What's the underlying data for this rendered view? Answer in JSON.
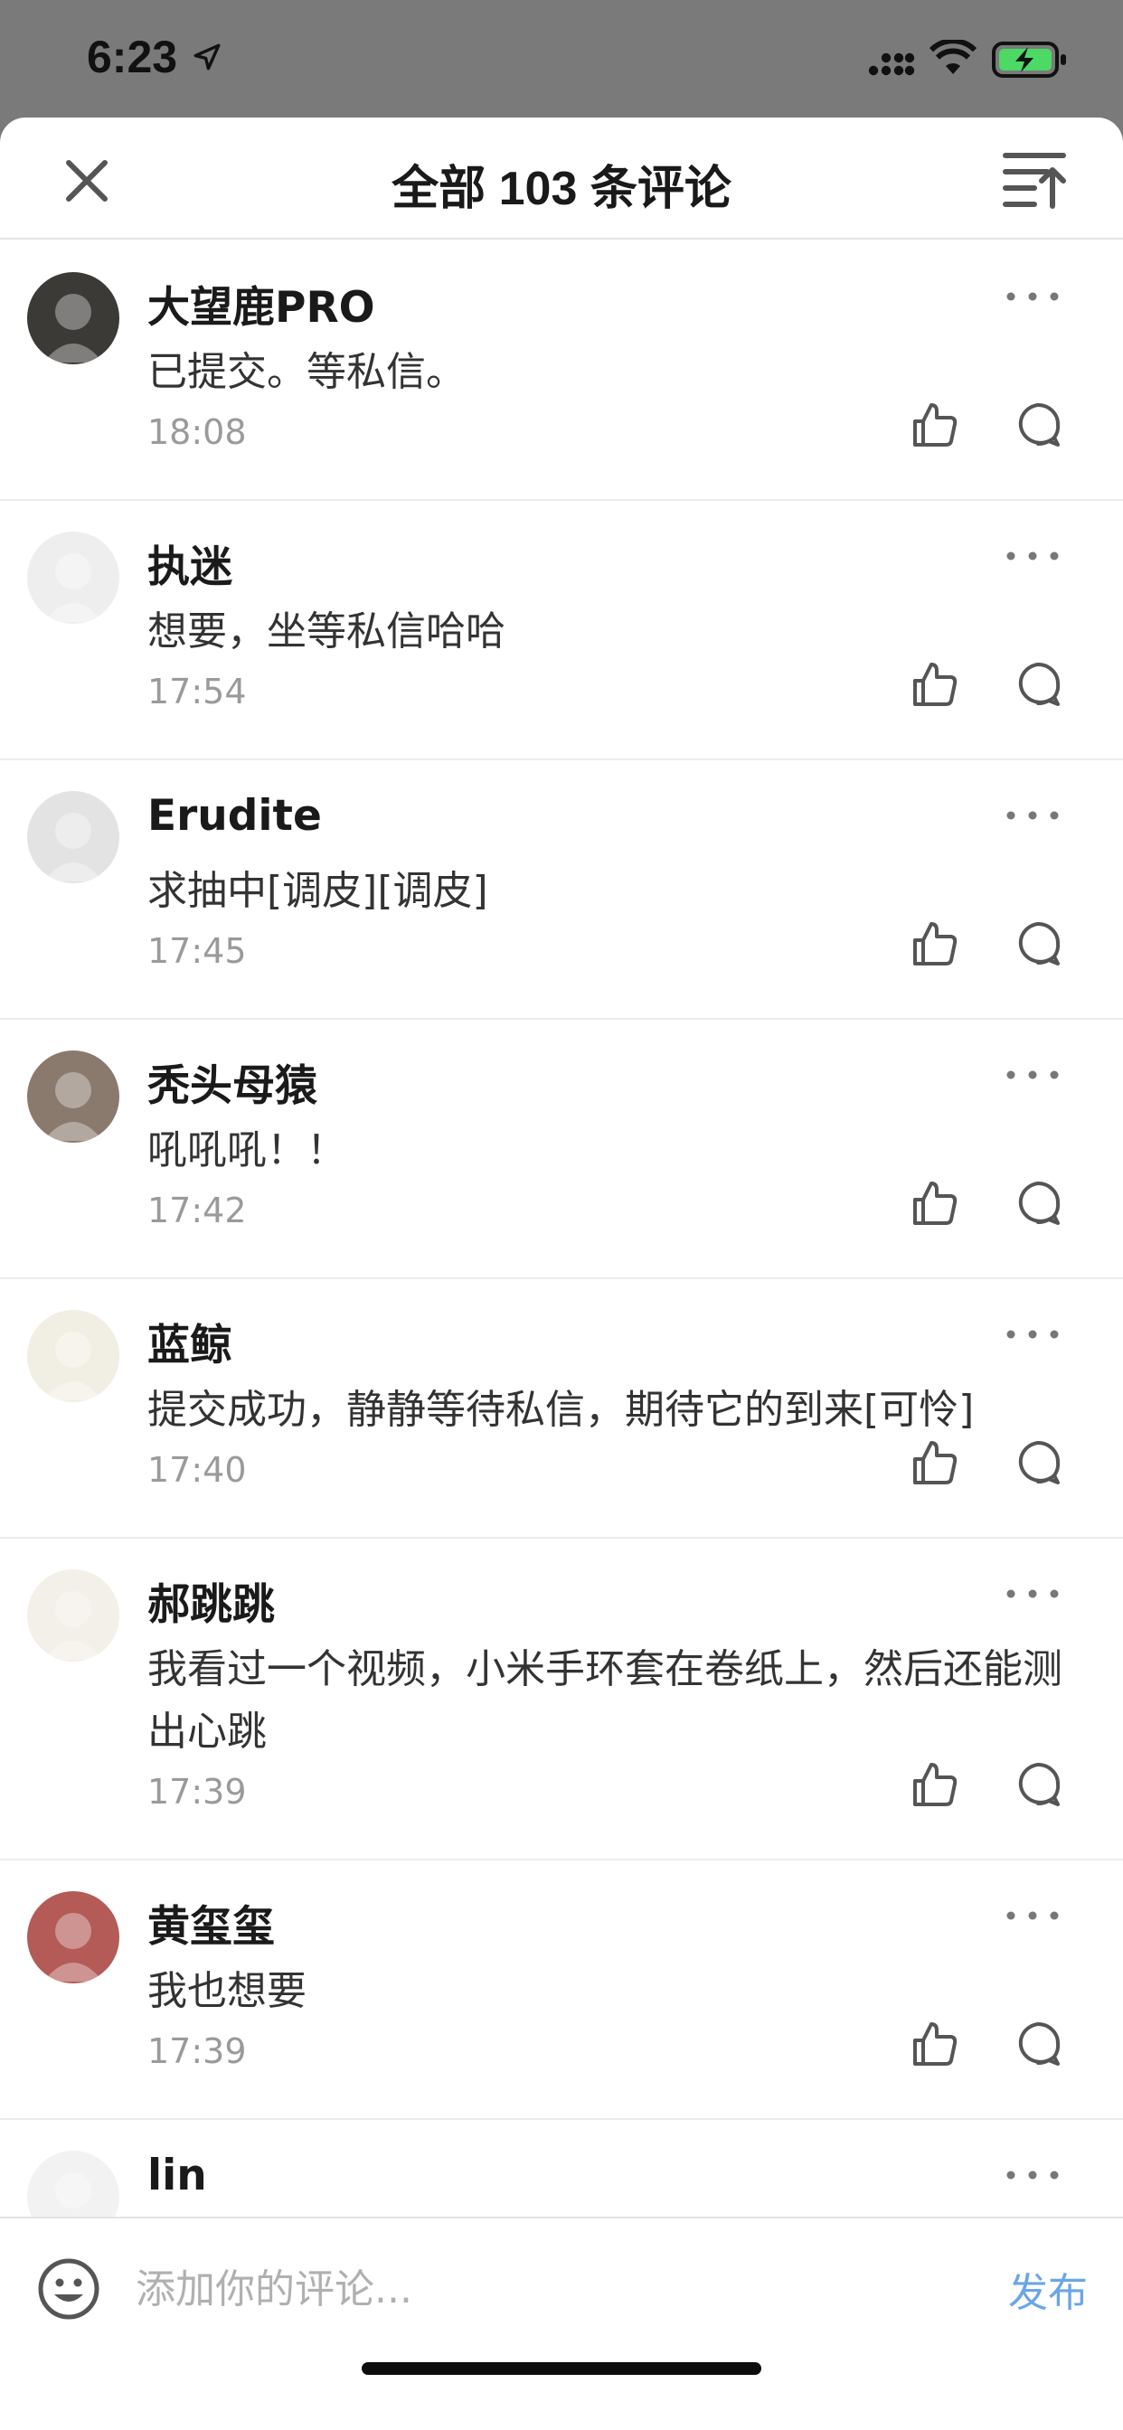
{
  "status_bar": {
    "time": "6:23",
    "icons": [
      "location-arrow-icon",
      "cellular-signal-icon",
      "wifi-icon",
      "battery-charging-icon"
    ]
  },
  "header": {
    "title": "全部 103 条评论",
    "close_icon": "close-icon",
    "sort_icon": "sort-icon"
  },
  "comments": [
    {
      "name": "大望鹿PRO",
      "text": "已提交。等私信。",
      "time": "18:08",
      "avatar_color": "#3b3a36"
    },
    {
      "name": "执迷",
      "text": "想要，坐等私信哈哈",
      "time": "17:54",
      "avatar_color": "#eeeeee"
    },
    {
      "name": "Erudite",
      "text": "求抽中[调皮][调皮]",
      "time": "17:45",
      "avatar_color": "#e3e3e3"
    },
    {
      "name": "秃头母猿",
      "text": "吼吼吼！！",
      "time": "17:42",
      "avatar_color": "#8a7a6e"
    },
    {
      "name": "蓝鲸",
      "text": "提交成功，静静等待私信，期待它的到来[可怜]",
      "time": "17:40",
      "avatar_color": "#f1eee4"
    },
    {
      "name": "郝跳跳",
      "text": "我看过一个视频，小米手环套在卷纸上，然后还能测出心跳",
      "time": "17:39",
      "avatar_color": "#f3efe9"
    },
    {
      "name": "黄玺玺",
      "text": "我也想要",
      "time": "17:39",
      "avatar_color": "#b45b57"
    },
    {
      "name": "lin",
      "text": "",
      "time": "",
      "avatar_color": "#f2f2f2"
    }
  ],
  "bottom_bar": {
    "input_placeholder": "添加你的评论...",
    "publish_label": "发布",
    "publish_color": "#6aa6e8",
    "emoji_icon": "emoji-smile-icon"
  },
  "colors": {
    "name": "#1a1a1a",
    "text": "#333333",
    "time": "#9a9a9a",
    "icon": "#555555"
  }
}
